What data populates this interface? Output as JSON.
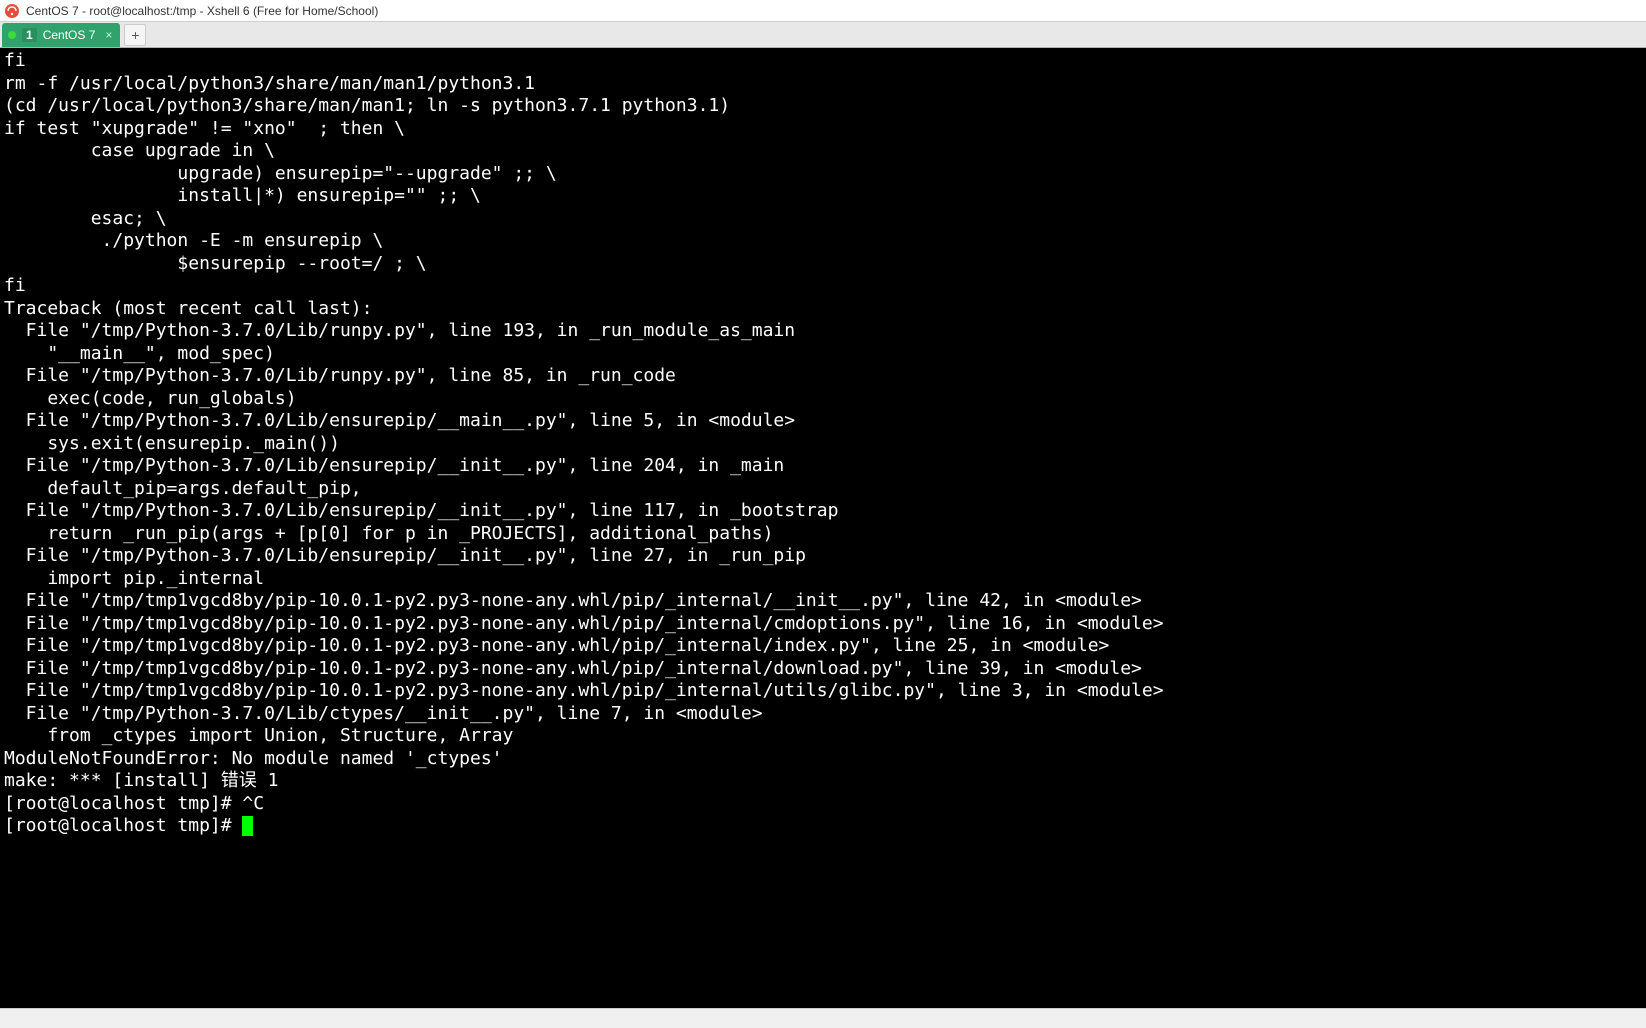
{
  "window": {
    "title": "CentOS 7 - root@localhost:/tmp - Xshell 6 (Free for Home/School)"
  },
  "tab": {
    "number": "1",
    "label": "CentOS 7"
  },
  "terminal": {
    "lines": [
      "fi",
      "rm -f /usr/local/python3/share/man/man1/python3.1",
      "(cd /usr/local/python3/share/man/man1; ln -s python3.7.1 python3.1)",
      "if test \"xupgrade\" != \"xno\"  ; then \\",
      "        case upgrade in \\",
      "                upgrade) ensurepip=\"--upgrade\" ;; \\",
      "                install|*) ensurepip=\"\" ;; \\",
      "        esac; \\",
      "         ./python -E -m ensurepip \\",
      "                $ensurepip --root=/ ; \\",
      "fi",
      "Traceback (most recent call last):",
      "  File \"/tmp/Python-3.7.0/Lib/runpy.py\", line 193, in _run_module_as_main",
      "    \"__main__\", mod_spec)",
      "  File \"/tmp/Python-3.7.0/Lib/runpy.py\", line 85, in _run_code",
      "    exec(code, run_globals)",
      "  File \"/tmp/Python-3.7.0/Lib/ensurepip/__main__.py\", line 5, in <module>",
      "    sys.exit(ensurepip._main())",
      "  File \"/tmp/Python-3.7.0/Lib/ensurepip/__init__.py\", line 204, in _main",
      "    default_pip=args.default_pip,",
      "  File \"/tmp/Python-3.7.0/Lib/ensurepip/__init__.py\", line 117, in _bootstrap",
      "    return _run_pip(args + [p[0] for p in _PROJECTS], additional_paths)",
      "  File \"/tmp/Python-3.7.0/Lib/ensurepip/__init__.py\", line 27, in _run_pip",
      "    import pip._internal",
      "  File \"/tmp/tmp1vgcd8by/pip-10.0.1-py2.py3-none-any.whl/pip/_internal/__init__.py\", line 42, in <module>",
      "  File \"/tmp/tmp1vgcd8by/pip-10.0.1-py2.py3-none-any.whl/pip/_internal/cmdoptions.py\", line 16, in <module>",
      "  File \"/tmp/tmp1vgcd8by/pip-10.0.1-py2.py3-none-any.whl/pip/_internal/index.py\", line 25, in <module>",
      "  File \"/tmp/tmp1vgcd8by/pip-10.0.1-py2.py3-none-any.whl/pip/_internal/download.py\", line 39, in <module>",
      "  File \"/tmp/tmp1vgcd8by/pip-10.0.1-py2.py3-none-any.whl/pip/_internal/utils/glibc.py\", line 3, in <module>",
      "  File \"/tmp/Python-3.7.0/Lib/ctypes/__init__.py\", line 7, in <module>",
      "    from _ctypes import Union, Structure, Array",
      "ModuleNotFoundError: No module named '_ctypes'",
      "make: *** [install] 错误 1",
      "[root@localhost tmp]# ^C"
    ],
    "prompt": "[root@localhost tmp]# "
  }
}
